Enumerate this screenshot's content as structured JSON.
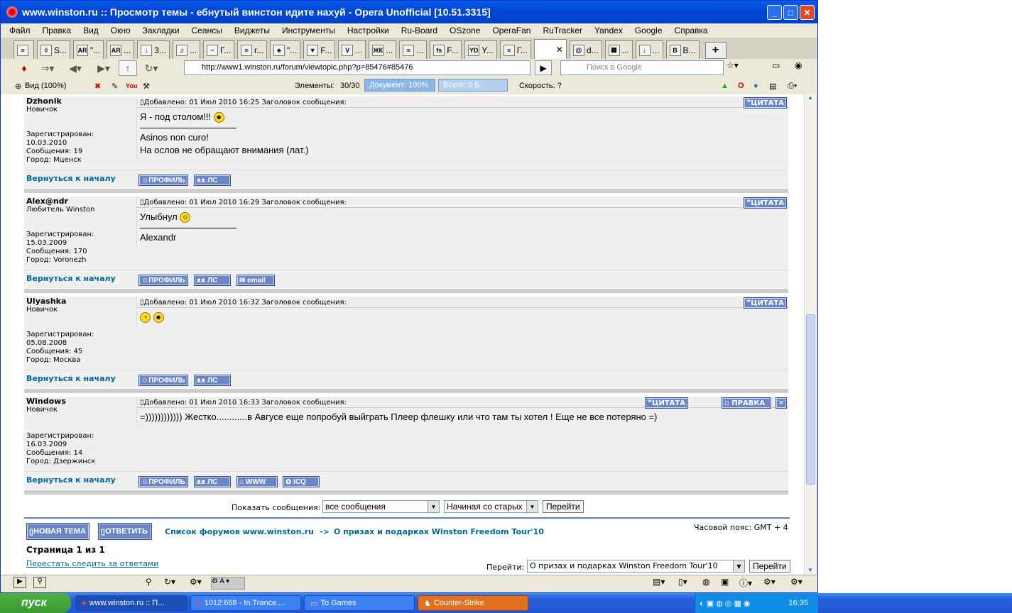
{
  "window": {
    "title": "www.winston.ru :: Просмотр темы - ебнутый винстон идите нахуй - Opera Unofficial [10.51.3315]"
  },
  "menu": [
    "Файл",
    "Правка",
    "Вид",
    "Окно",
    "Закладки",
    "Сеансы",
    "Виджеты",
    "Инструменты",
    "Настройки",
    "Ru-Board",
    "OSzone",
    "OperaFan",
    "RuTracker",
    "Yandex",
    "Google",
    "Справка"
  ],
  "tabs": [
    "S...",
    "\"...",
    "...",
    "3...",
    "...",
    "Г...",
    "г...",
    "\"...",
    "F...",
    "...",
    "...",
    "...",
    "F...",
    "Y...",
    "Г...",
    "",
    "d...",
    "...",
    "...",
    "В..."
  ],
  "nav": {
    "url": "http://www1.winston.ru/forum/viewtopic.php?p=85476#85476",
    "search_placeholder": "Поиск в Google"
  },
  "status": {
    "view": "Вид (100%)",
    "elements_label": "Элементы:",
    "elements_value": "30/30",
    "document": "Документ:   100%",
    "total": "Всего:   0 Б",
    "speed": "Скорость:   ?"
  },
  "posts": [
    {
      "user": "Dzhonik",
      "rank": "Новичок",
      "registered_label": "Зарегистрирован:",
      "registered": "10.03.2010",
      "messages": "Сообщения: 19",
      "city": "Город: Мценск",
      "header": "Добавлено: 01 Июл 2010 16:25    Заголовок сообщения:",
      "text": "Я - под столом!!!",
      "sig1": "Asinos non curo!",
      "sig2": "На ослов не обращают внимания (лат.)"
    },
    {
      "user": "Alex@ndr",
      "rank": "Любитель Winston",
      "registered_label": "Зарегистрирован:",
      "registered": "15.03.2009",
      "messages": "Сообщения: 170",
      "city": "Город: Voronezh",
      "header": "Добавлено: 01 Июл 2010 16:29    Заголовок сообщения:",
      "text": "Улыбнул",
      "sig1": "Alexandr"
    },
    {
      "user": "Ulyashka",
      "rank": "Новичок",
      "registered_label": "Зарегистрирован:",
      "registered": "05.08.2008",
      "messages": "Сообщения: 45",
      "city": "Город: Москва",
      "header": "Добавлено: 01 Июл 2010 16:32    Заголовок сообщения:"
    },
    {
      "user": "Windows",
      "rank": "Новичок",
      "registered_label": "Зарегистрирован:",
      "registered": "16.03.2009",
      "messages": "Сообщения: 14",
      "city": "Город: Дзержинск",
      "header": "Добавлено: 01 Июл 2010 16:33    Заголовок сообщения:",
      "text": "=)))))))))))) Жестко............в Авгусе еще попробуй выйграть Плеер флешку или что там ты хотел ! Еще не все потеряно =)"
    }
  ],
  "buttons": {
    "back_to_top": "Вернуться к началу",
    "profile": "ПРОФИЛЬ",
    "pm": "ЛС",
    "email": "email",
    "www": "WWW",
    "icq": "ICQ",
    "quote": "ЦИТАТА",
    "edit": "ПРАВКА"
  },
  "footer": {
    "show_label": "Показать сообщения:",
    "show_value": "все сообщения",
    "order_value": "Начиная со старых",
    "go": "Перейти",
    "new_topic": "НОВАЯ ТЕМА",
    "reply": "ОТВЕТИТЬ",
    "forum_list": "Список форумов www.winston.ru",
    "arrow": "->",
    "forum_name": "О призах и подарках Winston Freedom Tour'10",
    "timezone": "Часовой пояс: GMT + 4",
    "page": "Страница 1 из 1",
    "stop_watch": "Перестать следить за ответами",
    "jump_label": "Перейти:",
    "jump_value": "О призах и подарках Winston Freedom Tour'10"
  },
  "taskbar": {
    "start": "пуск",
    "items": [
      "www.winston.ru :: П...",
      "1012:668 - In.Trance....",
      "To Games",
      "Counter-Strike"
    ],
    "clock": "16:35"
  }
}
